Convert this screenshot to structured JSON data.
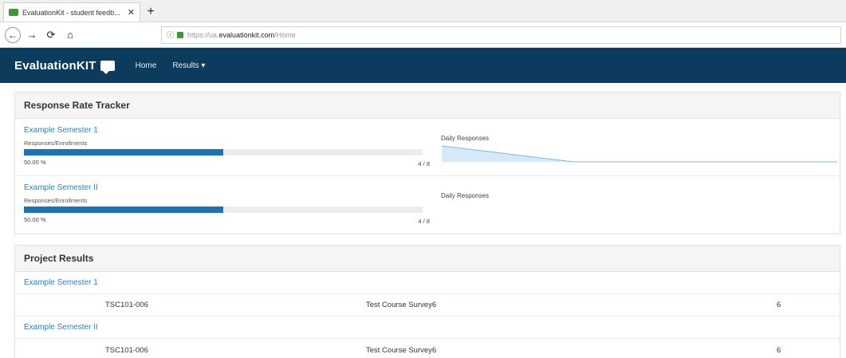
{
  "browser": {
    "tab_title": "EvaluationKit - student feedb...",
    "tab_close": "✕",
    "new_tab": "+",
    "url_protocol": "https://ua.",
    "url_domain": "evaluationkit.com",
    "url_path": "/Home"
  },
  "header": {
    "brand": "EvaluationKIT",
    "nav": [
      {
        "label": "Home"
      },
      {
        "label": "Results ▾"
      }
    ]
  },
  "response_tracker": {
    "title": "Response Rate Tracker",
    "rows": [
      {
        "semester": "Example Semester 1",
        "sub_label": "Responses/Enrollments",
        "percent_text": "50.00 %",
        "rate": 0.5,
        "count_text": "4 / 8",
        "daily_label": "Daily Responses",
        "daily_series": [
          4,
          0,
          0,
          0
        ]
      },
      {
        "semester": "Example Semester II",
        "sub_label": "Responses/Enrollments",
        "percent_text": "50.00 %",
        "rate": 0.5,
        "count_text": "4 / 8",
        "daily_label": "Daily Responses",
        "daily_series": []
      }
    ]
  },
  "project_results": {
    "title": "Project Results",
    "groups": [
      {
        "semester": "Example Semester 1",
        "rows": [
          {
            "code": "TSC101-006",
            "name": "Test Course Survey6",
            "count": "6"
          }
        ]
      },
      {
        "semester": "Example Semester II",
        "rows": [
          {
            "code": "TSC101-006",
            "name": "Test Course Survey6",
            "count": "6"
          }
        ]
      }
    ]
  }
}
